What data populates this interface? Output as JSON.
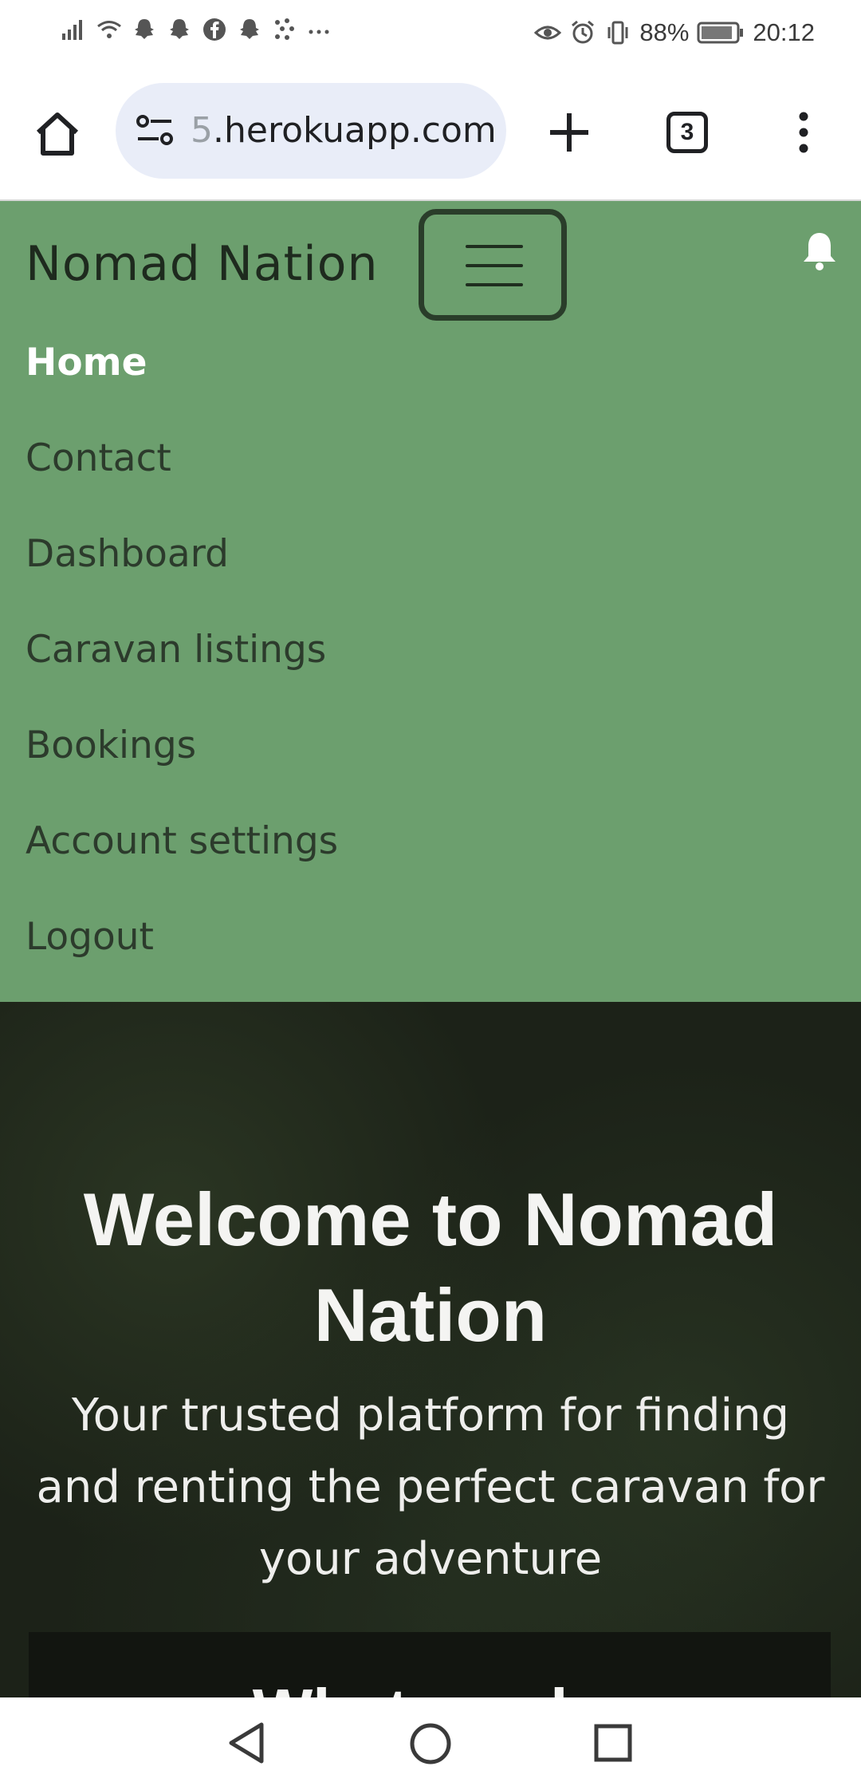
{
  "status_bar": {
    "battery": "88%",
    "time": "20:12",
    "left_icons": [
      "signal-icon",
      "wifi-icon",
      "snapchat-icon",
      "snapchat-icon",
      "facebook-icon",
      "snapchat-icon",
      "dots-grid-icon",
      "more-notifications-icon"
    ],
    "right_icons": [
      "eye-icon",
      "alarm-icon",
      "vibrate-icon",
      "battery-icon"
    ]
  },
  "browser": {
    "url_prefix": "5",
    "url": ".herokuapp.com",
    "tab_count": "3"
  },
  "navbar": {
    "brand": "Nomad Nation",
    "items": [
      {
        "label": "Home",
        "active": true
      },
      {
        "label": "Contact"
      },
      {
        "label": "Dashboard"
      },
      {
        "label": "Caravan listings"
      },
      {
        "label": "Bookings"
      },
      {
        "label": "Account settings"
      },
      {
        "label": "Logout"
      }
    ]
  },
  "hero": {
    "title": "Welcome to Nomad Nation",
    "subtitle": "Your trusted platform for finding and renting the perfect caravan for your adventure",
    "next_heading": "What we do"
  },
  "colors": {
    "navbar_bg": "#6c9f6e",
    "active_link": "#ffffff",
    "link": "#2c3b2c",
    "hero_bg": "#1c2218"
  }
}
